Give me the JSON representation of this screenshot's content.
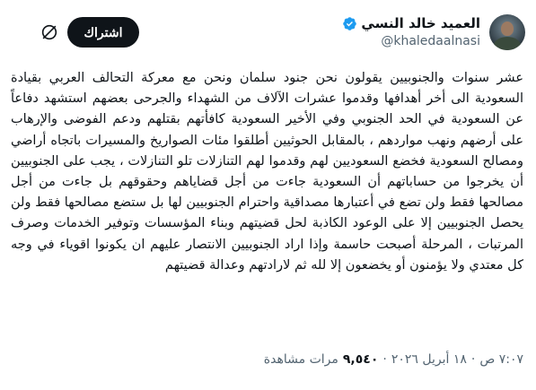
{
  "tweet": {
    "author": {
      "display_name": "العميد خالد النسي",
      "handle": "@khaledaalnasi",
      "verified": true
    },
    "subscribe_label": "اشتراك",
    "body": "عشر سنوات والجنوبيين يقولون نحن جنود سلمان ونحن مع معركة التحالف العربي بقيادة السعودية الى أخر أهدافها وقدموا عشرات الآلاف من الشهداء والجرحى بعضهم استشهد دفاعاً عن السعودية في الحد الجنوبي وفي الأخير السعودية كافأتهم بقتلهم ودعم الفوضى والإرهاب على أرضهم ونهب مواردهم ، بالمقابل الحوثيين أطلقوا مئات الصواريخ والمسيرات باتجاه أراضي ومصالح السعودية فخضع السعوديين لهم وقدموا لهم التنازلات تلو التنازلات ، يجب على الجنوبيين أن يخرجوا من حساباتهم أن السعودية جاءت من أجل قضاياهم وحقوقهم بل جاءت من أجل مصالحها فقط ولن تضع في أعتبارها مصداقية واحترام الجنوبيين لها بل ستضع مصالحها فقط ولن يحصل الجنوبيين إلا على الوعود الكاذبة لحل قضيتهم وبناء المؤسسات وتوفير الخدمات وصرف المرتبات ، المرحلة أصبحت حاسمة وإذا اراد الجنوبيين الانتصار عليهم ان يكونوا اقوياء في وجه كل معتدي ولا يؤمنون أو يخضعون إلا لله ثم لارادتهم وعدالة قضيتهم",
    "meta": {
      "time": "٧:٠٧ ص",
      "date": "١٨ أبريل ٢٠٢٦",
      "views_count": "٩,٥٤٠",
      "views_label": "مرات مشاهدة"
    }
  },
  "colors": {
    "text_primary": "#0f1419",
    "text_secondary": "#536471",
    "verified": "#1d9bf0",
    "button_bg": "#0f1419"
  },
  "icons": {
    "verified": "verified-badge-icon",
    "more": "grok-slash-icon"
  }
}
